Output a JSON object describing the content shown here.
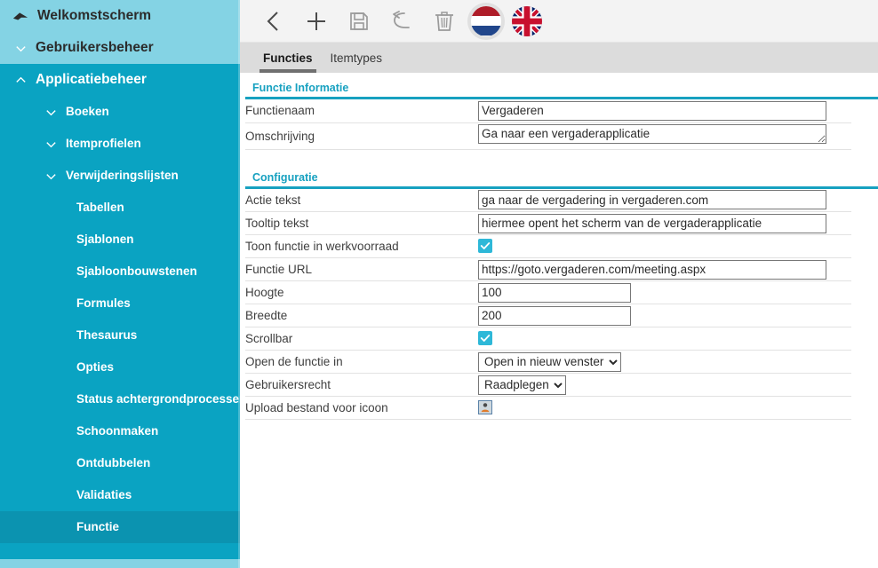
{
  "sidebar": {
    "collapse_icon": "chevron-left-icon",
    "items": [
      {
        "label": "Welkomstscherm",
        "level": 0,
        "icon": "home-icon",
        "style": "light",
        "selected": false
      },
      {
        "label": "Gebruikersbeheer",
        "level": 0,
        "icon": "chevron-down-icon",
        "style": "light",
        "selected": false
      },
      {
        "label": "Applicatiebeheer",
        "level": 0,
        "icon": "chevron-up-icon",
        "style": "normal",
        "selected": false
      },
      {
        "label": "Boeken",
        "level": 1,
        "icon": "chevron-down-icon",
        "style": "normal",
        "selected": false
      },
      {
        "label": "Itemprofielen",
        "level": 1,
        "icon": "chevron-down-icon",
        "style": "normal",
        "selected": false
      },
      {
        "label": "Verwijderingslijsten",
        "level": 1,
        "icon": "chevron-down-icon",
        "style": "normal",
        "selected": false
      },
      {
        "label": "Tabellen",
        "level": 2,
        "icon": "",
        "style": "normal",
        "selected": false
      },
      {
        "label": "Sjablonen",
        "level": 2,
        "icon": "",
        "style": "normal",
        "selected": false
      },
      {
        "label": "Sjabloonbouwstenen",
        "level": 2,
        "icon": "",
        "style": "normal",
        "selected": false
      },
      {
        "label": "Formules",
        "level": 2,
        "icon": "",
        "style": "normal",
        "selected": false
      },
      {
        "label": "Thesaurus",
        "level": 2,
        "icon": "",
        "style": "normal",
        "selected": false
      },
      {
        "label": "Opties",
        "level": 2,
        "icon": "",
        "style": "normal",
        "selected": false
      },
      {
        "label": "Status achtergrondprocessen",
        "level": 2,
        "icon": "",
        "style": "normal",
        "selected": false
      },
      {
        "label": "Schoonmaken",
        "level": 2,
        "icon": "",
        "style": "normal",
        "selected": false
      },
      {
        "label": "Ontdubbelen",
        "level": 2,
        "icon": "",
        "style": "normal",
        "selected": false
      },
      {
        "label": "Validaties",
        "level": 2,
        "icon": "",
        "style": "normal",
        "selected": false
      },
      {
        "label": "Functie",
        "level": 2,
        "icon": "",
        "style": "normal",
        "selected": true
      }
    ]
  },
  "toolbar": {
    "buttons": [
      {
        "name": "back-icon",
        "title": "Terug"
      },
      {
        "name": "plus-icon",
        "title": "Nieuw"
      },
      {
        "name": "save-icon",
        "title": "Opslaan"
      },
      {
        "name": "undo-icon",
        "title": "Ongedaan maken"
      },
      {
        "name": "trash-icon",
        "title": "Verwijderen"
      }
    ],
    "languages": [
      {
        "name": "flag-nl-icon",
        "code": "NL",
        "active": true
      },
      {
        "name": "flag-gb-icon",
        "code": "GB",
        "active": false
      }
    ]
  },
  "tabs": [
    {
      "label": "Functies",
      "active": true
    },
    {
      "label": "Itemtypes",
      "active": false
    }
  ],
  "sections": [
    {
      "title": "Functie Informatie",
      "fields": [
        {
          "label": "Functienaam",
          "type": "text",
          "value": "Vergaderen"
        },
        {
          "label": "Omschrijving",
          "type": "textarea",
          "value": "Ga naar een vergaderapplicatie"
        }
      ]
    },
    {
      "title": "Configuratie",
      "fields": [
        {
          "label": "Actie tekst",
          "type": "text",
          "value": "ga naar de vergadering in vergaderen.com"
        },
        {
          "label": "Tooltip tekst",
          "type": "text",
          "value": "hiermee opent het scherm van de vergaderapplicatie"
        },
        {
          "label": "Toon functie in werkvoorraad",
          "type": "checkbox",
          "value": true
        },
        {
          "label": "Functie URL",
          "type": "text",
          "value": "https://goto.vergaderen.com/meeting.aspx"
        },
        {
          "label": "Hoogte",
          "type": "number",
          "value": "100"
        },
        {
          "label": "Breedte",
          "type": "number",
          "value": "200"
        },
        {
          "label": "Scrollbar",
          "type": "checkbox",
          "value": true
        },
        {
          "label": "Open de functie in",
          "type": "select",
          "value": "Open in nieuw venster",
          "options": [
            "Open in nieuw venster"
          ]
        },
        {
          "label": "Gebruikersrecht",
          "type": "select",
          "value": "Raadplegen",
          "options": [
            "Raadplegen"
          ]
        },
        {
          "label": "Upload bestand voor icoon",
          "type": "upload",
          "value": "upload-icon"
        }
      ]
    }
  ],
  "colors": {
    "sidebar_bg": "#0aa3c2",
    "sidebar_light": "#84d3e4",
    "sidebar_selected": "#0b93b0",
    "accent_teal": "#17a1c0",
    "checkbox": "#2eb8d8",
    "toolbar_bg": "#f3f3f3",
    "tabbar_bg": "#dcdcdc"
  }
}
